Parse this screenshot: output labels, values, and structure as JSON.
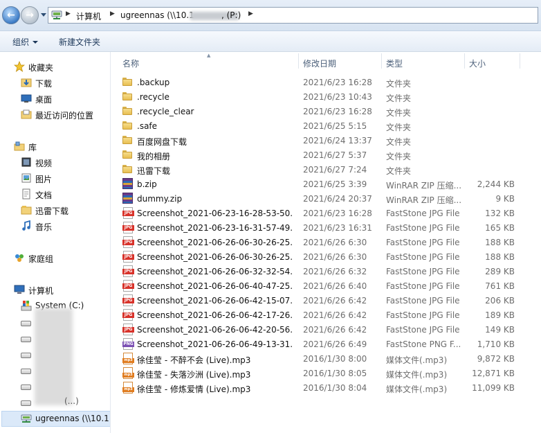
{
  "address": {
    "crumbs": [
      "计算机",
      "ugreennas (\\\\10.1",
      ", (P:)"
    ]
  },
  "toolbar": {
    "organize_label": "组织",
    "new_folder_label": "新建文件夹"
  },
  "nav": {
    "favorites_label": "收藏夹",
    "favorites": [
      "下载",
      "桌面",
      "最近访问的位置"
    ],
    "libraries_label": "库",
    "libraries": [
      "视频",
      "图片",
      "文档",
      "迅雷下载",
      "音乐"
    ],
    "homegroup_label": "家庭组",
    "computer_label": "计算机",
    "system_drive": "System (C:)",
    "partial_drive_suffix": "(...)",
    "network_drive": "ugreennas (\\\\10.1"
  },
  "columns": {
    "name": "名称",
    "date": "修改日期",
    "type": "类型",
    "size": "大小"
  },
  "files": [
    {
      "icon": "folder-icon",
      "name": ".backup",
      "date": "2021/6/23 16:28",
      "type": "文件夹",
      "size": ""
    },
    {
      "icon": "folder-icon",
      "name": ".recycle",
      "date": "2021/6/23 10:43",
      "type": "文件夹",
      "size": ""
    },
    {
      "icon": "folder-icon",
      "name": ".recycle_clear",
      "date": "2021/6/23 16:28",
      "type": "文件夹",
      "size": ""
    },
    {
      "icon": "folder-icon",
      "name": ".safe",
      "date": "2021/6/25 5:15",
      "type": "文件夹",
      "size": ""
    },
    {
      "icon": "folder-icon",
      "name": "百度网盘下载",
      "date": "2021/6/24 13:37",
      "type": "文件夹",
      "size": ""
    },
    {
      "icon": "folder-icon",
      "name": "我的相册",
      "date": "2021/6/27 5:37",
      "type": "文件夹",
      "size": ""
    },
    {
      "icon": "folder-icon",
      "name": "迅雷下载",
      "date": "2021/6/27 7:24",
      "type": "文件夹",
      "size": ""
    },
    {
      "icon": "winrar-icon",
      "name": "b.zip",
      "date": "2021/6/25 3:39",
      "type": "WinRAR ZIP 压缩...",
      "size": "2,244 KB"
    },
    {
      "icon": "winrar-icon",
      "name": "dummy.zip",
      "date": "2021/6/24 20:37",
      "type": "WinRAR ZIP 压缩...",
      "size": "9 KB"
    },
    {
      "icon": "jpg-file-icon",
      "name": "Screenshot_2021-06-23-16-28-53-50...",
      "date": "2021/6/23 16:28",
      "type": "FastStone JPG File",
      "size": "132 KB"
    },
    {
      "icon": "jpg-file-icon",
      "name": "Screenshot_2021-06-23-16-31-57-49...",
      "date": "2021/6/23 16:31",
      "type": "FastStone JPG File",
      "size": "165 KB"
    },
    {
      "icon": "jpg-file-icon",
      "name": "Screenshot_2021-06-26-06-30-26-25...",
      "date": "2021/6/26 6:30",
      "type": "FastStone JPG File",
      "size": "188 KB"
    },
    {
      "icon": "jpg-file-icon",
      "name": "Screenshot_2021-06-26-06-30-26-25...",
      "date": "2021/6/26 6:30",
      "type": "FastStone JPG File",
      "size": "188 KB"
    },
    {
      "icon": "jpg-file-icon",
      "name": "Screenshot_2021-06-26-06-32-32-54...",
      "date": "2021/6/26 6:32",
      "type": "FastStone JPG File",
      "size": "289 KB"
    },
    {
      "icon": "jpg-file-icon",
      "name": "Screenshot_2021-06-26-06-40-47-25...",
      "date": "2021/6/26 6:40",
      "type": "FastStone JPG File",
      "size": "761 KB"
    },
    {
      "icon": "jpg-file-icon",
      "name": "Screenshot_2021-06-26-06-42-15-07...",
      "date": "2021/6/26 6:42",
      "type": "FastStone JPG File",
      "size": "206 KB"
    },
    {
      "icon": "jpg-file-icon",
      "name": "Screenshot_2021-06-26-06-42-17-26...",
      "date": "2021/6/26 6:42",
      "type": "FastStone JPG File",
      "size": "189 KB"
    },
    {
      "icon": "jpg-file-icon",
      "name": "Screenshot_2021-06-26-06-42-20-56...",
      "date": "2021/6/26 6:42",
      "type": "FastStone JPG File",
      "size": "149 KB"
    },
    {
      "icon": "png-file-icon",
      "name": "Screenshot_2021-06-26-06-49-13-31...",
      "date": "2021/6/26 6:49",
      "type": "FastStone PNG F...",
      "size": "1,710 KB"
    },
    {
      "icon": "mp3-file-icon",
      "name": "徐佳莹 - 不醉不会 (Live).mp3",
      "date": "2016/1/30 8:00",
      "type": "媒体文件(.mp3)",
      "size": "9,872 KB"
    },
    {
      "icon": "mp3-file-icon",
      "name": "徐佳莹 - 失落沙洲 (Live).mp3",
      "date": "2016/1/30 8:05",
      "type": "媒体文件(.mp3)",
      "size": "12,871 KB"
    },
    {
      "icon": "mp3-file-icon",
      "name": "徐佳莹 - 修炼爱情 (Live).mp3",
      "date": "2016/1/30 8:04",
      "type": "媒体文件(.mp3)",
      "size": "11,099 KB"
    }
  ]
}
